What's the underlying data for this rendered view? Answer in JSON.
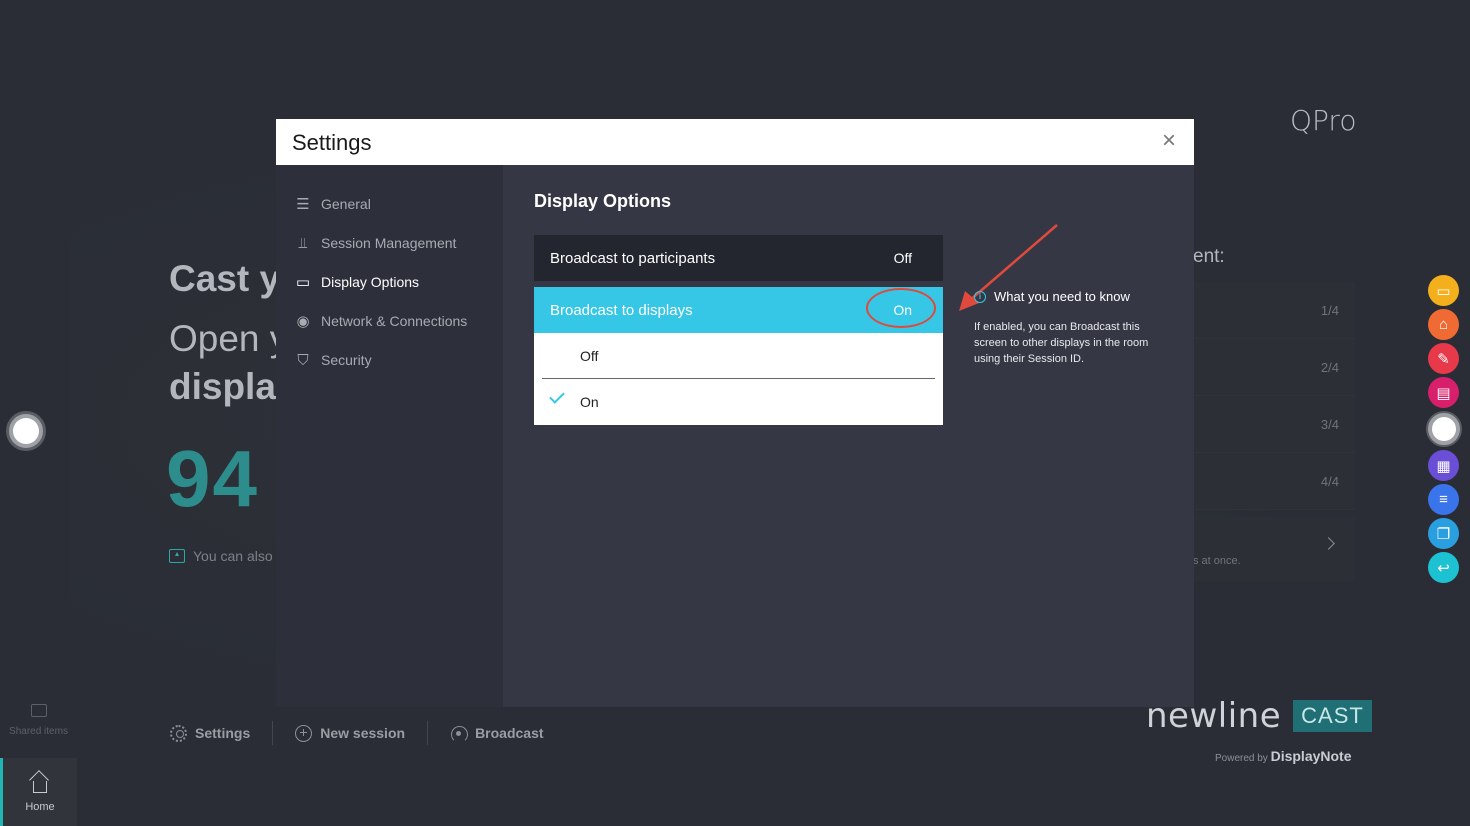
{
  "background": {
    "brand_top": "QPro",
    "cast_title": "Cast y",
    "cast_line1": "Open y",
    "cast_line2": "displa",
    "session_code": "94",
    "also_text": "You can also",
    "right_label": "ent:",
    "right_rows": [
      "1/4",
      "2/4",
      "3/4",
      "4/4"
    ],
    "right_footer_text": "s at once.",
    "brand_newline": "newline",
    "brand_cast": "CAST",
    "powered_by": "Powered by",
    "powered_brand": "DisplayNote"
  },
  "bottom_bar": {
    "settings": "Settings",
    "new_session": "New session",
    "broadcast": "Broadcast"
  },
  "left_nav": {
    "shared_items": "Shared items",
    "home": "Home"
  },
  "modal": {
    "title": "Settings",
    "close": "×",
    "sidebar": [
      {
        "label": "General",
        "icon": "list-icon"
      },
      {
        "label": "Session Management",
        "icon": "sliders-icon"
      },
      {
        "label": "Display Options",
        "icon": "monitor-icon",
        "active": true
      },
      {
        "label": "Network & Connections",
        "icon": "broadcast-signal-icon"
      },
      {
        "label": "Security",
        "icon": "shield-icon"
      }
    ],
    "content": {
      "title": "Display Options",
      "option1": {
        "label": "Broadcast to participants",
        "value": "Off"
      },
      "option2": {
        "label": "Broadcast to displays",
        "value": "On"
      },
      "dropdown": {
        "items": [
          "Off",
          "On"
        ],
        "selected": "On"
      },
      "info": {
        "heading": "What you need to know",
        "body": "If enabled, you can Broadcast this screen to other displays in the room using their Session ID."
      }
    }
  },
  "colors": {
    "accent": "#36c6e6",
    "annotation": "#e04a3c",
    "teal": "#1fb5b5"
  }
}
